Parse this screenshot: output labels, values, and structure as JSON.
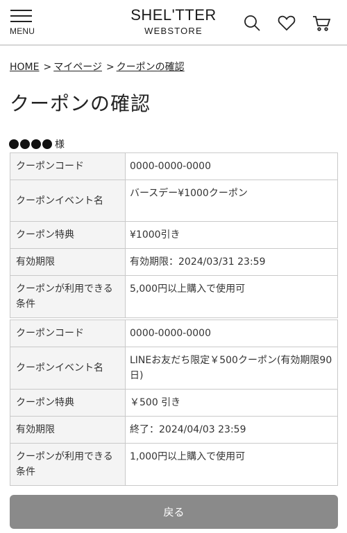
{
  "header": {
    "menu_label": "MENU",
    "logo_main": "SHEL'TTER",
    "logo_sub": "WEBSTORE",
    "icons": [
      "menu-icon",
      "search-icon",
      "heart-icon",
      "cart-icon"
    ]
  },
  "breadcrumb": {
    "items": [
      "HOME",
      "マイページ",
      "クーポンの確認"
    ],
    "separator": ">"
  },
  "page_title": "クーポンの確認",
  "customer": {
    "masked_name": "●●●●",
    "suffix": "様"
  },
  "coupons": [
    {
      "rows": [
        {
          "label": "クーポンコード",
          "value": "0000-0000-0000"
        },
        {
          "label": "クーポンイベント名",
          "value": "バースデー¥1000クーポン"
        },
        {
          "label": "クーポン特典",
          "value": "¥1000引き"
        },
        {
          "label": "有効期限",
          "value": "有効期限：2024/03/31 23:59"
        },
        {
          "label": "クーポンが利用できる条件",
          "value": "5,000円以上購入で使用可"
        }
      ]
    },
    {
      "rows": [
        {
          "label": "クーポンコード",
          "value": "0000-0000-0000"
        },
        {
          "label": "クーポンイベント名",
          "value": "LINEお友だち限定￥500クーポン(有効期限90日)"
        },
        {
          "label": "クーポン特典",
          "value": "￥500 引き"
        },
        {
          "label": "有効期限",
          "value": "終了：2024/04/03 23:59"
        },
        {
          "label": "クーポンが利用できる条件",
          "value": "1,000円以上購入で使用可"
        }
      ]
    }
  ],
  "back_button": "戻る",
  "colors": {
    "label_bg": "#f4f4f4",
    "border": "#c9c9c9",
    "button_bg": "#8a8a8a",
    "text": "#222222"
  }
}
